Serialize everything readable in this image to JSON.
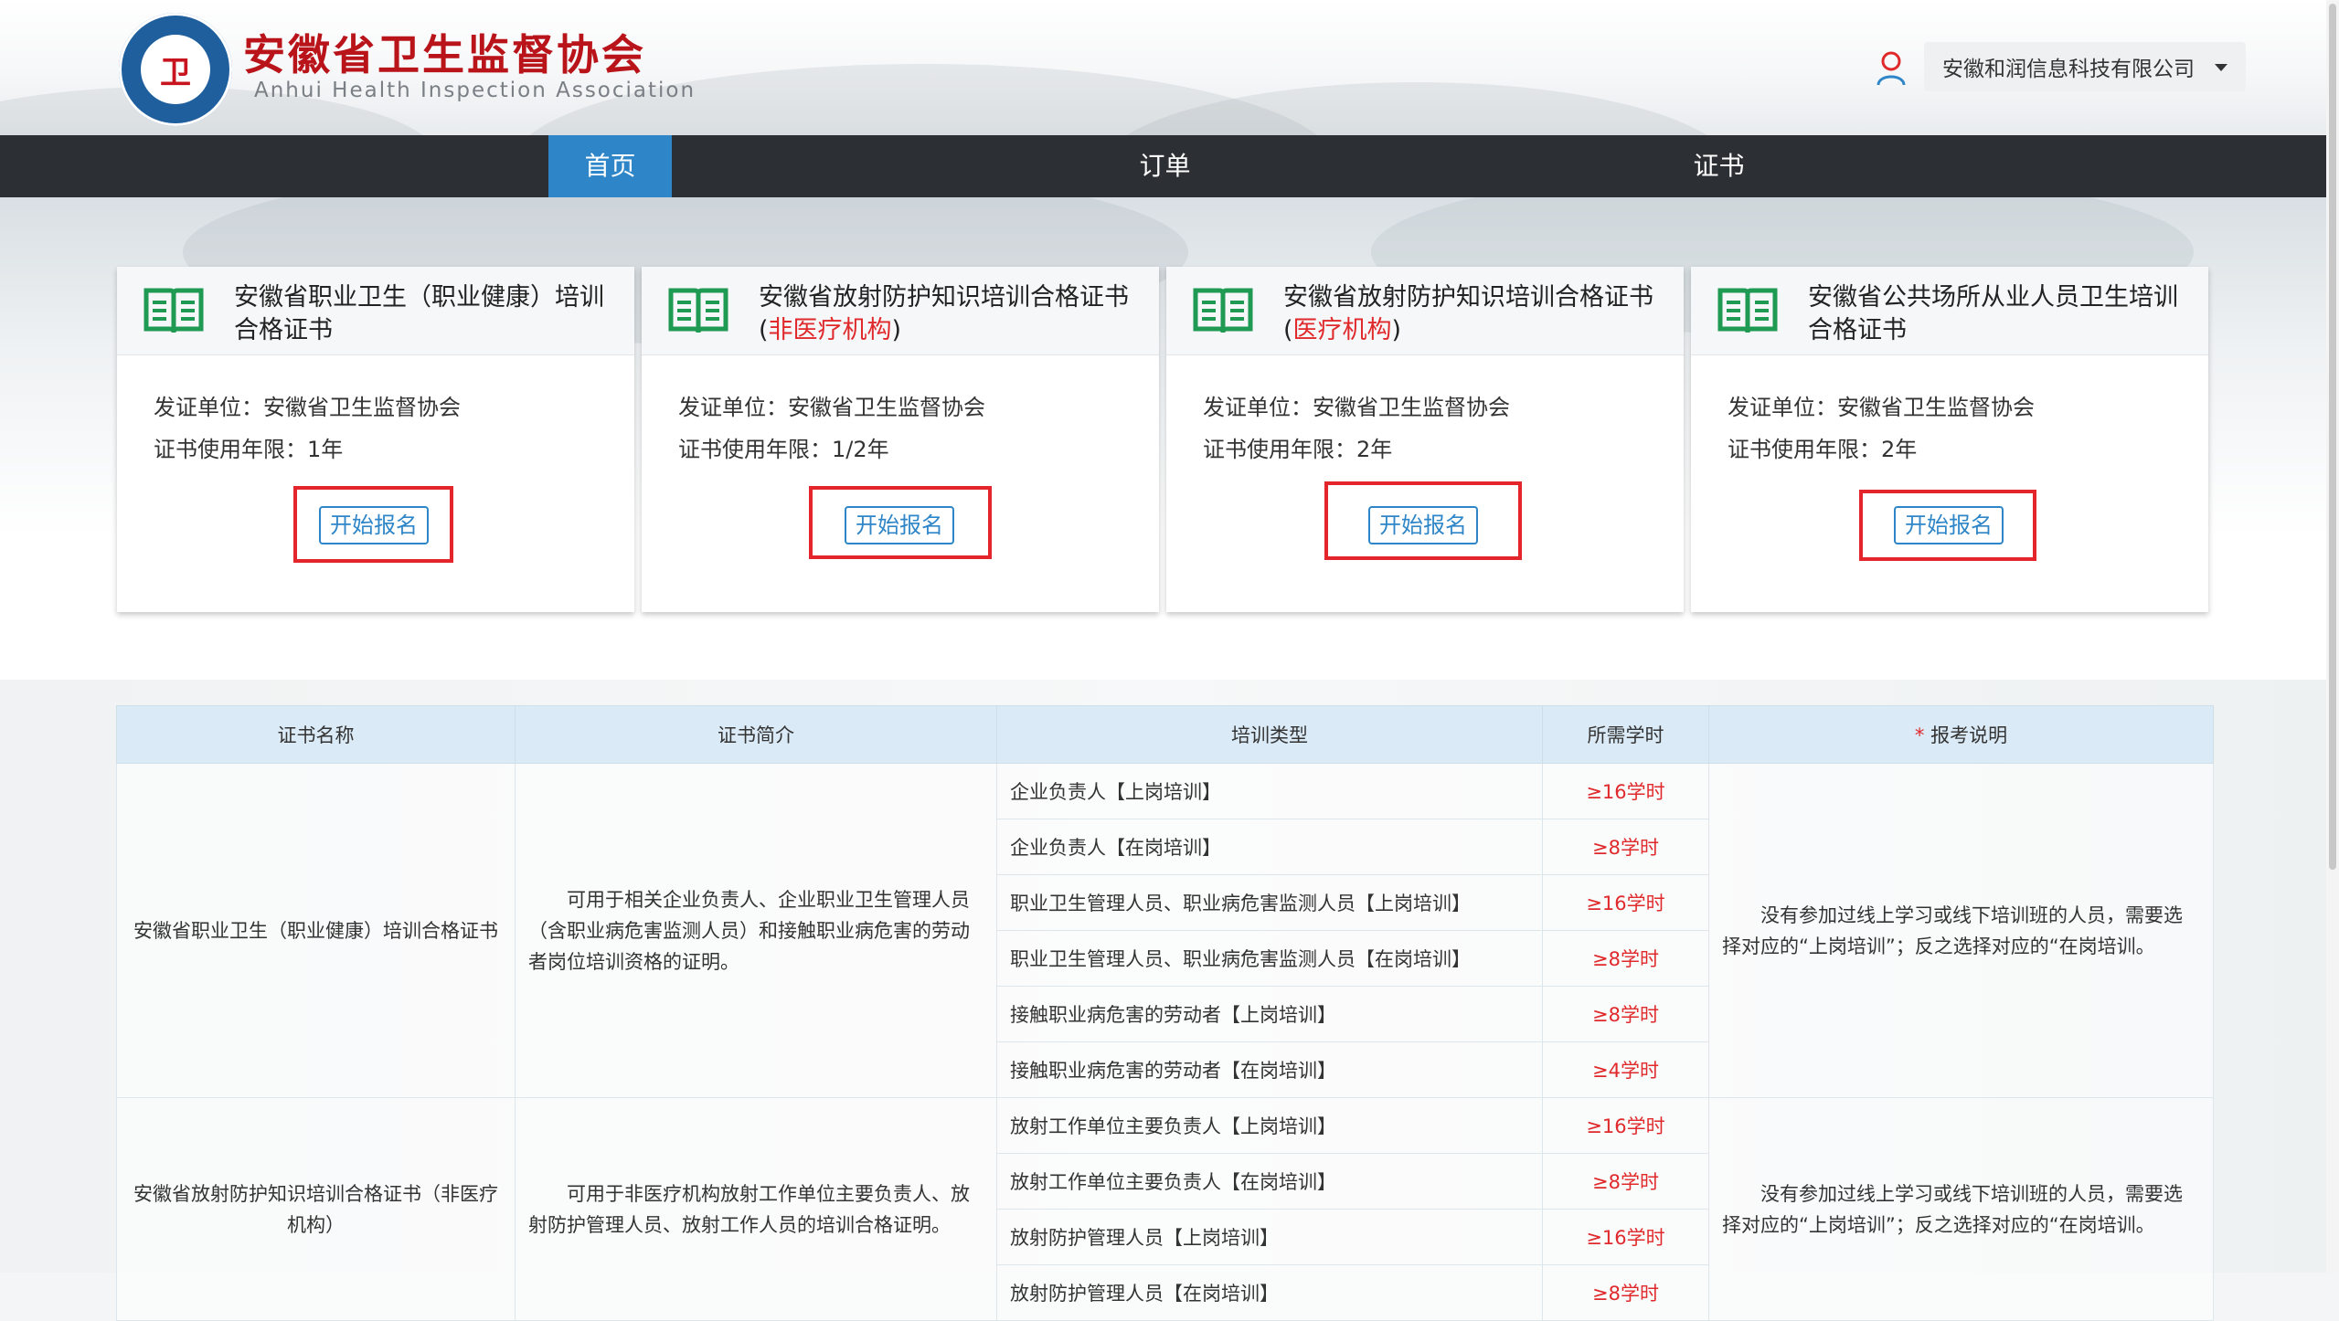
{
  "header": {
    "logo_text": "卫",
    "site_title": "安徽省卫生监督协会",
    "site_subtitle": "Anhui Health Inspection Association",
    "user_company": "安徽和润信息科技有限公司"
  },
  "nav": {
    "items": [
      {
        "label": "首页"
      },
      {
        "label": "订单"
      },
      {
        "label": "证书"
      }
    ]
  },
  "cards": [
    {
      "title_line1": "安徽省职业卫生（职业健康）培训",
      "title_line2": "合格证书",
      "issuer": "发证单位：安徽省卫生监督协会",
      "validity": "证书使用年限：1年",
      "button": "开始报名"
    },
    {
      "title_line1": "安徽省放射防护知识培训合格证书",
      "title_open": "(",
      "title_red": "非医疗机构",
      "title_close": ")",
      "issuer": "发证单位：安徽省卫生监督协会",
      "validity": "证书使用年限：1/2年",
      "button": "开始报名"
    },
    {
      "title_line1": "安徽省放射防护知识培训合格证书",
      "title_open": "(",
      "title_red": "医疗机构",
      "title_close": ")",
      "issuer": "发证单位：安徽省卫生监督协会",
      "validity": "证书使用年限：2年",
      "button": "开始报名"
    },
    {
      "title_line1": "安徽省公共场所从业人员卫生培训",
      "title_line2": "合格证书",
      "issuer": "发证单位：安徽省卫生监督协会",
      "validity": "证书使用年限：2年",
      "button": "开始报名"
    }
  ],
  "table": {
    "headers": {
      "name": "证书名称",
      "intro": "证书简介",
      "type": "培训类型",
      "hours": "所需学时",
      "note_star": "*",
      "note": "报考说明"
    },
    "groups": [
      {
        "name": "安徽省职业卫生（职业健康）培训合格证书",
        "intro": "可用于相关企业负责人、企业职业卫生管理人员（含职业病危害监测人员）和接触职业病危害的劳动者岗位培训资格的证明。",
        "note": "没有参加过线上学习或线下培训班的人员，需要选择对应的“上岗培训”；反之选择对应的“在岗培训。",
        "rows": [
          {
            "type": "企业负责人【上岗培训】",
            "hours": "≥16学时"
          },
          {
            "type": "企业负责人【在岗培训】",
            "hours": "≥8学时"
          },
          {
            "type": "职业卫生管理人员、职业病危害监测人员【上岗培训】",
            "hours": "≥16学时"
          },
          {
            "type": "职业卫生管理人员、职业病危害监测人员【在岗培训】",
            "hours": "≥8学时"
          },
          {
            "type": "接触职业病危害的劳动者【上岗培训】",
            "hours": "≥8学时"
          },
          {
            "type": "接触职业病危害的劳动者【在岗培训】",
            "hours": "≥4学时"
          }
        ]
      },
      {
        "name": "安徽省放射防护知识培训合格证书（非医疗机构）",
        "intro": "可用于非医疗机构放射工作单位主要负责人、放射防护管理人员、放射工作人员的培训合格证明。",
        "note": "没有参加过线上学习或线下培训班的人员，需要选择对应的“上岗培训”；反之选择对应的“在岗培训。",
        "rows": [
          {
            "type": "放射工作单位主要负责人【上岗培训】",
            "hours": "≥16学时"
          },
          {
            "type": "放射工作单位主要负责人【在岗培训】",
            "hours": "≥8学时"
          },
          {
            "type": "放射防护管理人员【上岗培训】",
            "hours": "≥16学时"
          },
          {
            "type": "放射防护管理人员【在岗培训】",
            "hours": "≥8学时"
          }
        ]
      }
    ]
  },
  "colors": {
    "brand_red": "#b8141a",
    "accent_blue": "#2e86c8",
    "nav_dark": "#2c3035",
    "highlight_red": "#e4262c",
    "icon_green": "#1e9a52"
  }
}
